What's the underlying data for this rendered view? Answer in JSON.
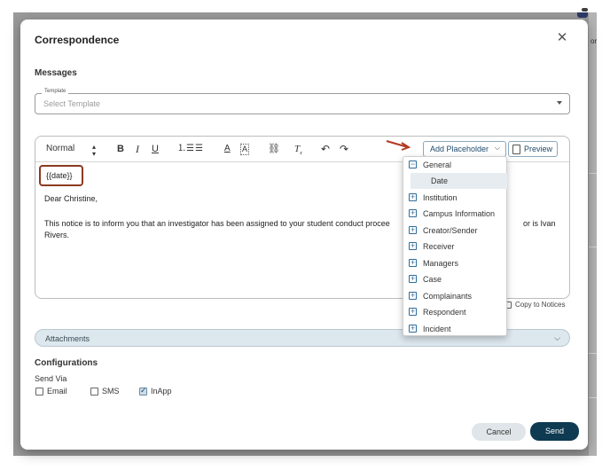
{
  "background": {
    "right_edge_text": "or"
  },
  "modal": {
    "title": "Correspondence",
    "close_icon": "close-icon"
  },
  "messages": {
    "heading": "Messages",
    "template_label": "Template",
    "template_placeholder": "Select Template"
  },
  "toolbar": {
    "style_value": "Normal",
    "bold": "B",
    "italic": "I",
    "underline": "U",
    "add_placeholder_label": "Add Placeholder",
    "preview_label": "Preview"
  },
  "editor": {
    "date_token": "{{date}}",
    "greeting": "Dear Christine,",
    "body_line1": "This notice is to inform you that an investigator has been assigned to your student conduct procee",
    "body_line1_end": "or is Ivan",
    "body_line2": "Rivers."
  },
  "placeholder_menu": {
    "items": [
      {
        "label": "General",
        "expanded": true
      },
      {
        "label": "Date",
        "child": true
      },
      {
        "label": "Institution",
        "expanded": false
      },
      {
        "label": "Campus Information",
        "expanded": false
      },
      {
        "label": "Creator/Sender",
        "expanded": false
      },
      {
        "label": "Receiver",
        "expanded": false
      },
      {
        "label": "Managers",
        "expanded": false
      },
      {
        "label": "Case",
        "expanded": false
      },
      {
        "label": "Complainants",
        "expanded": false
      },
      {
        "label": "Respondent",
        "expanded": false
      },
      {
        "label": "Incident",
        "expanded": false
      }
    ]
  },
  "copy_to_notices": "Copy to Notices",
  "attachments": {
    "label": "Attachments"
  },
  "configurations": {
    "heading": "Configurations",
    "send_via": "Send Via",
    "options": [
      {
        "label": "Email",
        "checked": false
      },
      {
        "label": "SMS",
        "checked": false
      },
      {
        "label": "InApp",
        "checked": true
      }
    ]
  },
  "footer": {
    "cancel_label": "Cancel",
    "send_label": "Send"
  },
  "colors": {
    "primary": "#0e3a52",
    "highlight_border": "#8b3a22",
    "accent_blue": "#2f6d9a",
    "attachments_bg": "#dde8ee"
  }
}
